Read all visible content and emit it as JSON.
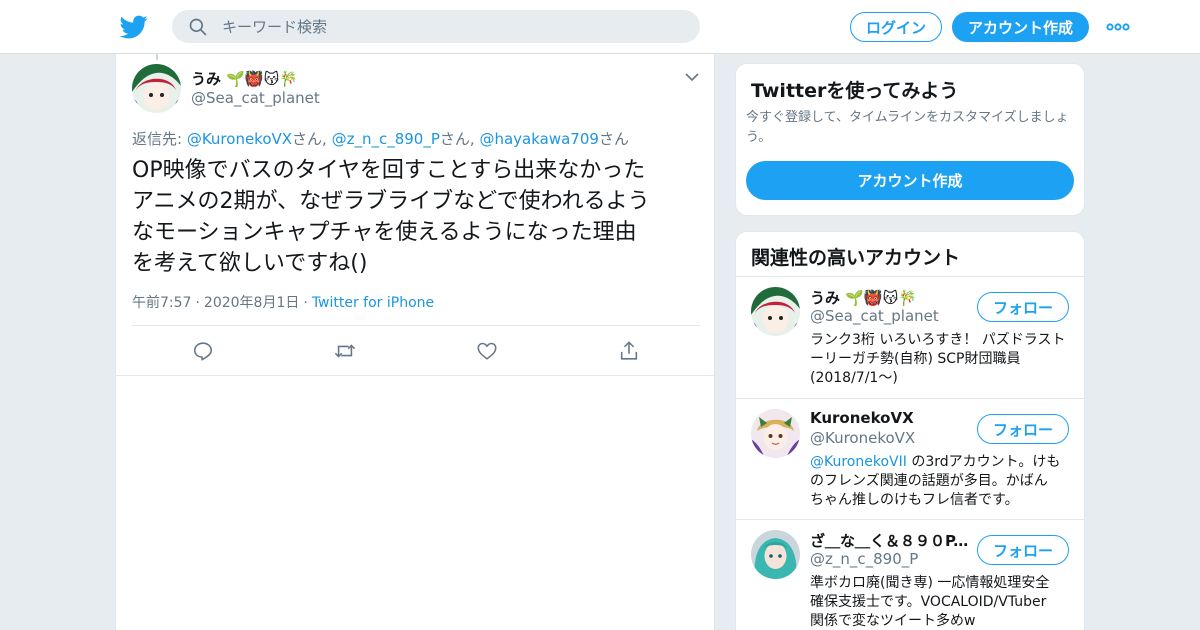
{
  "header": {
    "search_placeholder": "キーワード検索",
    "login_label": "ログイン",
    "signup_label": "アカウント作成"
  },
  "tweet": {
    "display_name": "うみ 🌱👹😽🎋",
    "screen_name": "@Sea_cat_planet",
    "reply_prefix": "返信先: ",
    "reply_mentions": [
      {
        "handle": "@KuronekoVX",
        "suffix": "さん, "
      },
      {
        "handle": "@z_n_c_890_P",
        "suffix": "さん, "
      },
      {
        "handle": "@hayakawa709",
        "suffix": "さん"
      }
    ],
    "text_lines": [
      "OP映像でバスのタイヤを回すことすら出来なかった",
      "アニメの2期が、なぜラブライブなどで使われるよう",
      "なモーションキャプチャを使えるようになった理由",
      "を考えて欲しいですね()"
    ],
    "time": "午前7:57",
    "date": "2020年8月1日",
    "separator": "·",
    "source": "Twitter for iPhone"
  },
  "signup_card": {
    "title": "Twitterを使ってみよう",
    "subtitle": "今すぐ登録して、タイムラインをカスタマイズしましょう。",
    "button_label": "アカウント作成"
  },
  "related": {
    "title": "関連性の高いアカウント",
    "follow_label": "フォロー",
    "accounts": [
      {
        "name": "うみ 🌱👹😽🎋",
        "handle": "@Sea_cat_planet",
        "bio_mention": "",
        "bio_lines": [
          "ランク3桁 いろいろすき！ パズドラスト",
          "ーリーガチ勢(自称) SCP財団職員",
          "(2018/7/1〜)"
        ]
      },
      {
        "name": "KuronekoVX",
        "handle": "@KuronekoVX",
        "bio_mention": "@KuronekoVII",
        "bio_lines": [
          " の3rdアカウント。けも",
          "のフレンズ関連の話題が多目。かばん",
          "ちゃん推しのけもフレ信者です。"
        ]
      },
      {
        "name": "ざ＿な＿く＆８９０P...",
        "handle": "@z_n_c_890_P",
        "bio_mention": "",
        "bio_lines": [
          "準ボカロ廃(聞き専) 一応情報処理安全",
          "確保支援士です。VOCALOID/VTuber",
          "関係で変なツイート多めw"
        ]
      }
    ]
  },
  "colors": {
    "brand": "#1da1f2",
    "link": "#1b95e0",
    "muted": "#657786",
    "background": "#e6ecf0"
  },
  "icons": [
    "twitter-bird-icon",
    "search-icon",
    "more-dots-icon",
    "chevron-down-icon",
    "reply-icon",
    "retweet-icon",
    "like-icon",
    "share-icon"
  ]
}
